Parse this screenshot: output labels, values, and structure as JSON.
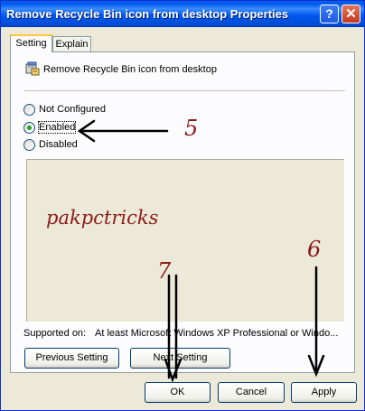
{
  "window": {
    "title": "Remove Recycle Bin icon from desktop Properties"
  },
  "titlebar": {
    "help_label": "?",
    "close_label": "✕"
  },
  "tabs": [
    {
      "label": "Setting"
    },
    {
      "label": "Explain"
    }
  ],
  "policy": {
    "name": "Remove Recycle Bin icon from desktop",
    "icon": "policy-setting-icon"
  },
  "options": [
    {
      "label": "Not Configured",
      "selected": false
    },
    {
      "label": "Enabled",
      "selected": true
    },
    {
      "label": "Disabled",
      "selected": false
    }
  ],
  "explain": {
    "watermark": "pakpctricks"
  },
  "supported": {
    "label": "Supported on:",
    "value": "At least Microsoft Windows XP Professional or Windo..."
  },
  "nav": {
    "previous_label": "Previous Setting",
    "next_label": "Next Setting"
  },
  "footer": {
    "ok_label": "OK",
    "cancel_label": "Cancel",
    "apply_label": "Apply"
  },
  "annotations": {
    "enabled_number": "5",
    "apply_number": "6",
    "ok_number": "7"
  },
  "colors": {
    "titlebar": "#0058ee",
    "annotation": "#8b1a1a",
    "selected_radio": "#21a121"
  }
}
